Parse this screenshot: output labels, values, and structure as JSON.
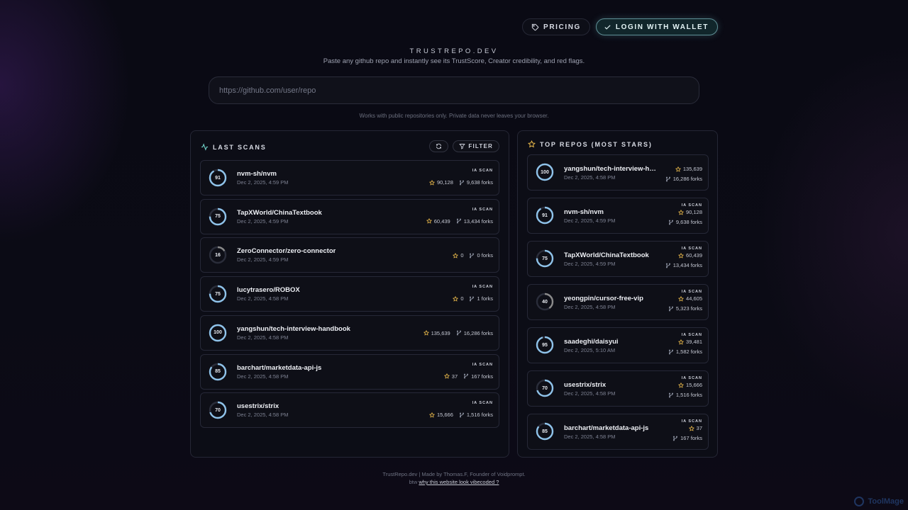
{
  "nav": {
    "pricing": "PRICING",
    "login": "LOGIN WITH WALLET"
  },
  "hero": {
    "brand": "TRUSTREPO.DEV",
    "tagline": "Paste any github repo and instantly see its TrustScore, Creator credibility, and red flags.",
    "placeholder": "https://github.com/user/repo",
    "note": "Works with public repositories only. Private data never leaves your browser."
  },
  "last_scans": {
    "title": "LAST SCANS",
    "filter_label": "FILTER",
    "items": [
      {
        "score": "91",
        "name": "nvm-sh/nvm",
        "date": "Dec 2, 2025, 4:59 PM",
        "badge": "IA SCAN",
        "stars": "90,128",
        "forks": "9,638 forks"
      },
      {
        "score": "75",
        "name": "TapXWorld/ChinaTextbook",
        "date": "Dec 2, 2025, 4:59 PM",
        "badge": "IA SCAN",
        "stars": "60,439",
        "forks": "13,434 forks"
      },
      {
        "score": "16",
        "name": "ZeroConnector/zero-connector",
        "date": "Dec 2, 2025, 4:59 PM",
        "badge": "",
        "stars": "0",
        "forks": "0 forks"
      },
      {
        "score": "75",
        "name": "lucytrasero/ROBOX",
        "date": "Dec 2, 2025, 4:58 PM",
        "badge": "IA SCAN",
        "stars": "0",
        "forks": "1 forks"
      },
      {
        "score": "100",
        "name": "yangshun/tech-interview-handbook",
        "date": "Dec 2, 2025, 4:58 PM",
        "badge": "",
        "stars": "135,639",
        "forks": "16,286 forks"
      },
      {
        "score": "85",
        "name": "barchart/marketdata-api-js",
        "date": "Dec 2, 2025, 4:58 PM",
        "badge": "IA SCAN",
        "stars": "37",
        "forks": "167 forks"
      },
      {
        "score": "70",
        "name": "usestrix/strix",
        "date": "Dec 2, 2025, 4:58 PM",
        "badge": "IA SCAN",
        "stars": "15,666",
        "forks": "1,516 forks"
      }
    ]
  },
  "top_repos": {
    "title": "TOP REPOS (MOST STARS)",
    "items": [
      {
        "score": "100",
        "name": "yangshun/tech-interview-han...",
        "date": "Dec 2, 2025, 4:58 PM",
        "badge": "",
        "stars": "135,639",
        "forks": "16,286 forks"
      },
      {
        "score": "91",
        "name": "nvm-sh/nvm",
        "date": "Dec 2, 2025, 4:59 PM",
        "badge": "IA SCAN",
        "stars": "90,128",
        "forks": "9,638 forks"
      },
      {
        "score": "75",
        "name": "TapXWorld/ChinaTextbook",
        "date": "Dec 2, 2025, 4:59 PM",
        "badge": "IA SCAN",
        "stars": "60,439",
        "forks": "13,434 forks"
      },
      {
        "score": "40",
        "name": "yeongpin/cursor-free-vip",
        "date": "Dec 2, 2025, 4:58 PM",
        "badge": "IA SCAN",
        "stars": "44,605",
        "forks": "5,323 forks"
      },
      {
        "score": "95",
        "name": "saadeghi/daisyui",
        "date": "Dec 2, 2025, 5:10 AM",
        "badge": "IA SCAN",
        "stars": "39,481",
        "forks": "1,582 forks"
      },
      {
        "score": "70",
        "name": "usestrix/strix",
        "date": "Dec 2, 2025, 4:58 PM",
        "badge": "IA SCAN",
        "stars": "15,666",
        "forks": "1,516 forks"
      },
      {
        "score": "85",
        "name": "barchart/marketdata-api-js",
        "date": "Dec 2, 2025, 4:58 PM",
        "badge": "IA SCAN",
        "stars": "37",
        "forks": "167 forks"
      }
    ]
  },
  "footer": {
    "line1": "TrustRepo.dev | Made by Thomas.F, Founder of Voidprompt.",
    "line2_prefix": "btw",
    "line2_link": "why this website look vibecoded ?"
  },
  "watermark": "ToolMage",
  "colors": {
    "ring_high": "#8fc3ea",
    "ring_low": "#8a8a8a",
    "star": "#e8b84a",
    "accent": "#6fd1c7"
  }
}
